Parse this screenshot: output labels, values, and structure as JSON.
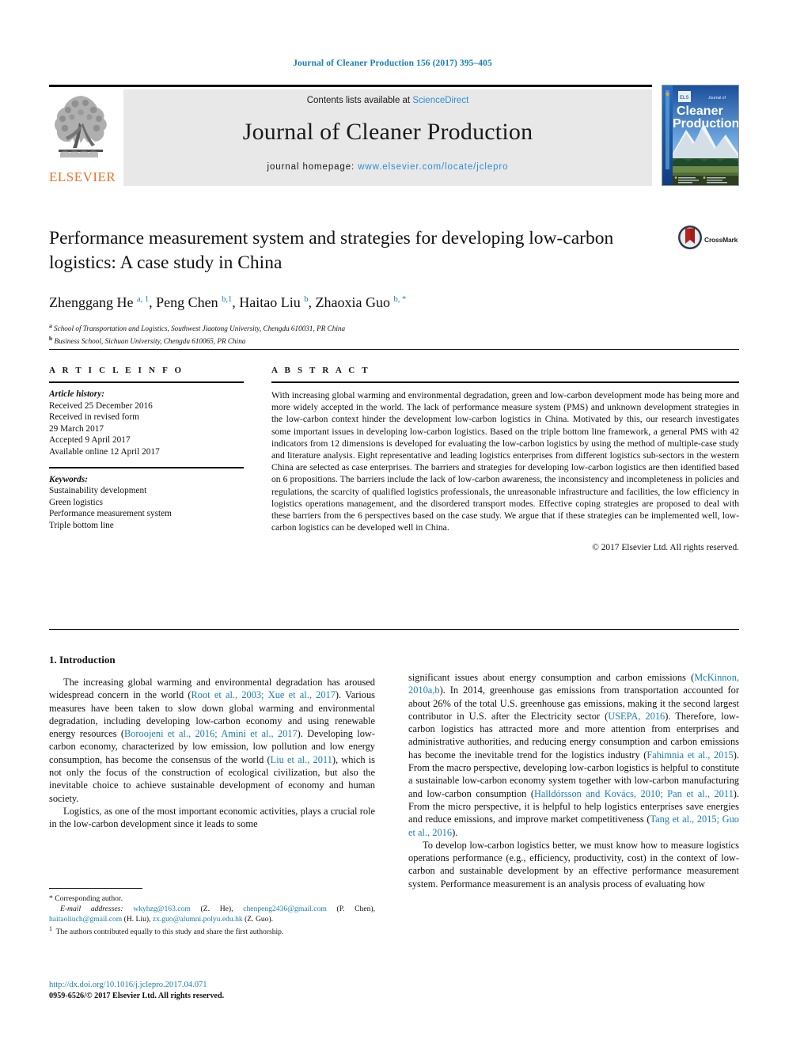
{
  "running_head": "Journal of Cleaner Production 156 (2017) 395–405",
  "masthead": {
    "contents_prefix": "Contents lists available at ",
    "sciencedirect": "ScienceDirect",
    "journal_name": "Journal of Cleaner Production",
    "homepage_prefix": "journal homepage: ",
    "homepage_url": "www.elsevier.com/locate/jclepro",
    "publisher": "ELSEVIER",
    "cover_title_line1": "Cleaner",
    "cover_title_line2": "Production",
    "cover_kicker": "Journal of",
    "accent_blue": "#2a8fd4",
    "elsevier_orange": "#e87324",
    "band_gray": "#e8e8e8"
  },
  "crossmark": {
    "label": "CrossMark"
  },
  "article": {
    "title": "Performance measurement system and strategies for developing low-carbon logistics: A case study in China",
    "authors_html": "Zhenggang He <sup>a, 1</sup>, Peng Chen <sup>b,1</sup>, Haitao Liu <sup>b</sup>, Zhaoxia Guo <sup>b, *</sup>",
    "affiliations": [
      {
        "mark": "a",
        "text": "School of Transportation and Logistics, Southwest Jiaotong University, Chengdu 610031, PR China"
      },
      {
        "mark": "b",
        "text": "Business School, Sichuan University, Chengdu 610065, PR China"
      }
    ]
  },
  "article_info": {
    "heading": "A R T I C L E   I N F O",
    "history_label": "Article history:",
    "history": [
      "Received 25 December 2016",
      "Received in revised form",
      "29 March 2017",
      "Accepted 9 April 2017",
      "Available online 12 April 2017"
    ],
    "keywords_label": "Keywords:",
    "keywords": [
      "Sustainability development",
      "Green logistics",
      "Performance measurement system",
      "Triple bottom line"
    ]
  },
  "abstract": {
    "heading": "A B S T R A C T",
    "text": "With increasing global warming and environmental degradation, green and low-carbon development mode has being more and more widely accepted in the world. The lack of performance measure system (PMS) and unknown development strategies in the low-carbon context hinder the development low-carbon logistics in China. Motivated by this, our research investigates some important issues in developing low-carbon logistics. Based on the triple bottom line framework, a general PMS with 42 indicators from 12 dimensions is developed for evaluating the low-carbon logistics by using the method of multiple-case study and literature analysis. Eight representative and leading logistics enterprises from different logistics sub-sectors in the western China are selected as case enterprises. The barriers and strategies for developing low-carbon logistics are then identified based on 6 propositions. The barriers include the lack of low-carbon awareness, the inconsistency and incompleteness in policies and regulations, the scarcity of qualified logistics professionals, the unreasonable infrastructure and facilities, the low efficiency in logistics operations management, and the disordered transport modes. Effective coping strategies are proposed to deal with these barriers from the 6 perspectives based on the case study. We argue that if these strategies can be implemented well, low-carbon logistics can be developed well in China.",
    "copyright": "© 2017 Elsevier Ltd. All rights reserved."
  },
  "introduction": {
    "heading": "1. Introduction",
    "left_paragraphs": [
      "The increasing global warming and environmental degradation has aroused widespread concern in the world (<span class=\"cite\">Root et al., 2003; Xue et al., 2017</span>). Various measures have been taken to slow down global warming and environmental degradation, including developing low-carbon economy and using renewable energy resources (<span class=\"cite\">Boroojeni et al., 2016; Amini et al., 2017</span>). Developing low-carbon economy, characterized by low emission, low pollution and low energy consumption, has become the consensus of the world (<span class=\"cite\">Liu et al., 2011</span>), which is not only the focus of the construction of ecological civilization, but also the inevitable choice to achieve sustainable development of economy and human society.",
      "Logistics, as one of the most important economic activities, plays a crucial role in the low-carbon development since it leads to some"
    ],
    "right_paragraphs": [
      "significant issues about energy consumption and carbon emissions (<span class=\"cite\">McKinnon, 2010a,b</span>). In 2014, greenhouse gas emissions from transportation accounted for about 26% of the total U.S. greenhouse gas emissions, making it the second largest contributor in U.S. after the Electricity sector (<span class=\"cite\">USEPA, 2016</span>). Therefore, low-carbon logistics has attracted more and more attention from enterprises and administrative authorities, and reducing energy consumption and carbon emissions has become the inevitable trend for the logistics industry (<span class=\"cite\">Fahimnia et al., 2015</span>). From the macro perspective, developing low-carbon logistics is helpful to constitute a sustainable low-carbon economy system together with low-carbon manufacturing and low-carbon consumption (<span class=\"cite\">Halldórsson and Kovács, 2010; Pan et al., 2011</span>). From the micro perspective, it is helpful to help logistics enterprises save energies and reduce emissions, and improve market competitiveness (<span class=\"cite\">Tang et al., 2015; Guo et al., 2016</span>).",
      "To develop low-carbon logistics better, we must know how to measure logistics operations performance (e.g., efficiency, productivity, cost) in the context of low-carbon and sustainable development by an effective performance measurement system. Performance measurement is an analysis process of evaluating how"
    ]
  },
  "footnotes": {
    "corresponding": "* Corresponding author.",
    "emails_html": "<span class=\"fn-em\">E-mail addresses:</span> <span class=\"mail\">wkyhzg@163.com</span> (Z. He), <span class=\"mail\">chenpeng2436@gmail.com</span> (P. Chen), <span class=\"mail\">haitaoliuch@gmail.com</span> (H. Liu), <span class=\"mail\">zx.guo@alumni.polyu.edu.hk</span> (Z. Guo).",
    "equal_contribution": "<sup>1</sup>&nbsp; The authors contributed equally to this study and share the first authorship."
  },
  "footer": {
    "doi": "http://dx.doi.org/10.1016/j.jclepro.2017.04.071",
    "issn_line": "0959-6526/© 2017 Elsevier Ltd. All rights reserved."
  }
}
